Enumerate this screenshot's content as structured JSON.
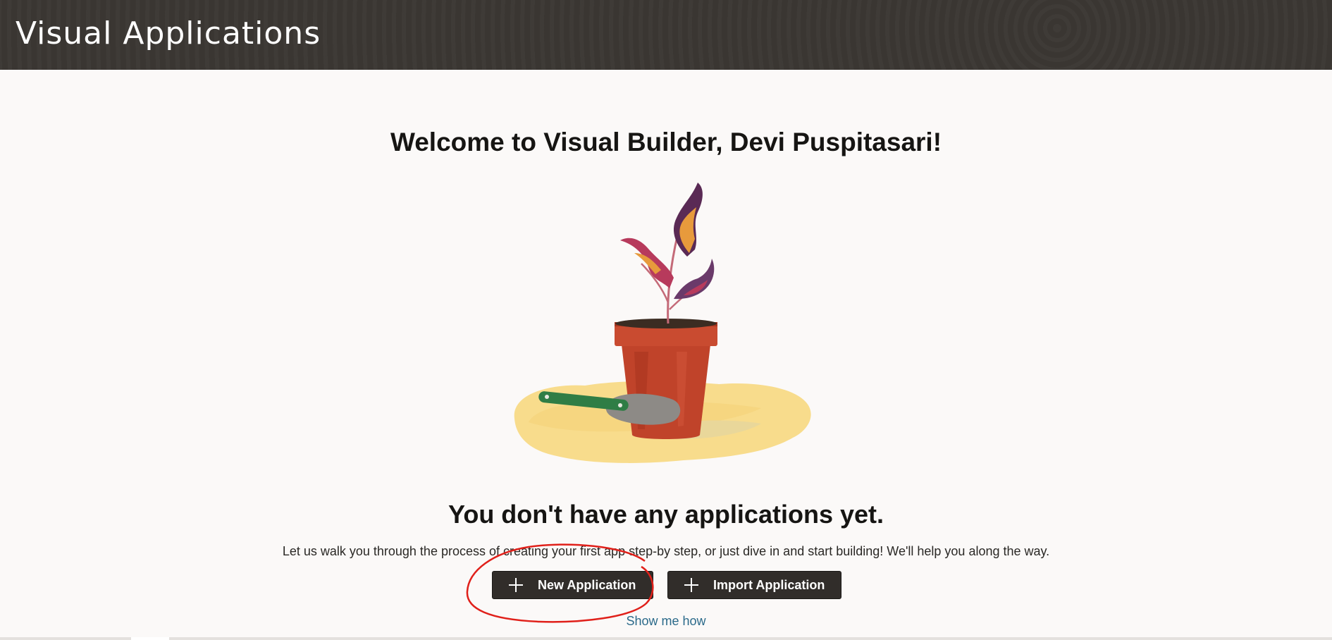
{
  "header": {
    "title": "Visual Applications"
  },
  "main": {
    "welcome": "Welcome to Visual Builder, Devi Puspitasari!",
    "empty_title": "You don't have any applications yet.",
    "empty_description": "Let us walk you through the process of creating your first app step-by step, or just dive in and start building! We'll help you along the way.",
    "buttons": {
      "new_application": "New Application",
      "import_application": "Import Application"
    },
    "show_me_how": "Show me how"
  },
  "icons": {
    "new_application": "plus-icon",
    "import_application": "plus-icon"
  },
  "colors": {
    "header_bg": "#3a3632",
    "page_bg": "#fbf9f8",
    "button_bg": "#312d2a",
    "link": "#2b6a8a",
    "annotation": "#e0201a"
  }
}
